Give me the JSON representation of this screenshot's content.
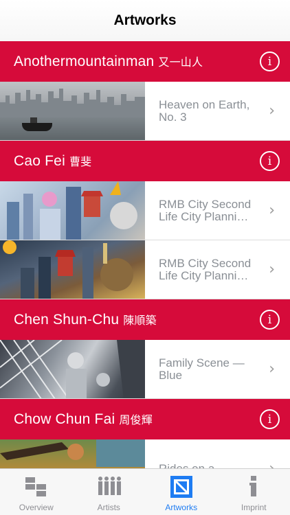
{
  "nav": {
    "title": "Artworks"
  },
  "sections": [
    {
      "artist": "Anothermountainman",
      "artist_cjk": "又一山人",
      "artworks": [
        {
          "title": "Heaven on Earth, No. 3"
        }
      ]
    },
    {
      "artist": "Cao Fei",
      "artist_cjk": "曹斐",
      "artworks": [
        {
          "title": "RMB City Second Life City Planni…"
        },
        {
          "title": "RMB City Second Life City Planni…"
        }
      ]
    },
    {
      "artist": "Chen Shun-Chu",
      "artist_cjk": "陳順築",
      "artworks": [
        {
          "title": "Family Scene — Blue"
        }
      ]
    },
    {
      "artist": "Chow Chun Fai",
      "artist_cjk": "周俊輝",
      "artworks": [
        {
          "title": "Rides on a"
        }
      ]
    }
  ],
  "icons": {
    "info": "i",
    "chevron": "›"
  },
  "tabs": [
    {
      "label": "Overview",
      "icon": "overview-icon",
      "active": false
    },
    {
      "label": "Artists",
      "icon": "artists-icon",
      "active": false
    },
    {
      "label": "Artworks",
      "icon": "artworks-icon",
      "active": true
    },
    {
      "label": "Imprint",
      "icon": "imprint-icon",
      "active": false
    }
  ],
  "colors": {
    "accent": "#d60b3a",
    "tab_active": "#1e7cf2",
    "tab_inactive": "#8e8e93"
  }
}
